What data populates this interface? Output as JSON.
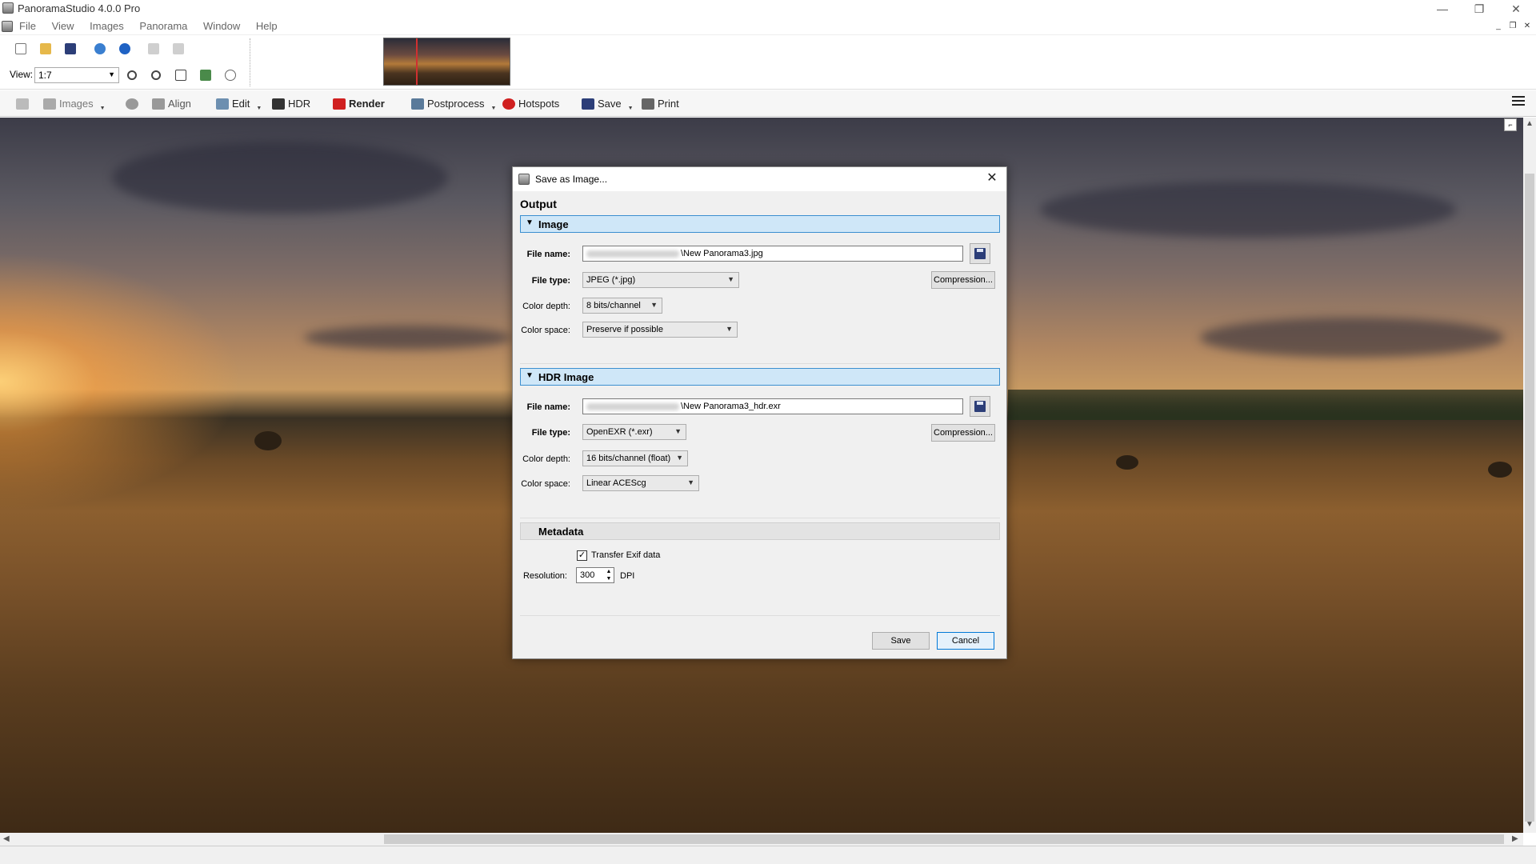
{
  "window": {
    "title": "PanoramaStudio 4.0.0 Pro",
    "minimize": "—",
    "restore": "❐",
    "close": "✕"
  },
  "menubar": [
    "File",
    "View",
    "Images",
    "Panorama",
    "Window",
    "Help"
  ],
  "view": {
    "label": "View:",
    "zoom": "1:7"
  },
  "workflow": {
    "images": "Images",
    "align": "Align",
    "edit": "Edit",
    "hdr": "HDR",
    "render": "Render",
    "postprocess": "Postprocess",
    "hotspots": "Hotspots",
    "save": "Save",
    "print": "Print"
  },
  "dialog": {
    "title": "Save as Image...",
    "heading": "Output",
    "image_section": {
      "title": "Image",
      "file_name_label": "File name:",
      "file_name": "\\New Panorama3.jpg",
      "file_type_label": "File type:",
      "file_type": "JPEG (*.jpg)",
      "compression": "Compression...",
      "color_depth_label": "Color depth:",
      "color_depth": "8 bits/channel",
      "color_space_label": "Color space:",
      "color_space": "Preserve if possible"
    },
    "hdr_section": {
      "title": "HDR Image",
      "file_name_label": "File name:",
      "file_name": "\\New Panorama3_hdr.exr",
      "file_type_label": "File type:",
      "file_type": "OpenEXR (*.exr)",
      "compression": "Compression...",
      "color_depth_label": "Color depth:",
      "color_depth": "16 bits/channel (float)",
      "color_space_label": "Color space:",
      "color_space": "Linear ACEScg"
    },
    "metadata_section": {
      "title": "Metadata",
      "transfer_exif_label": "Transfer Exif data",
      "transfer_exif_checked": true,
      "resolution_label": "Resolution:",
      "resolution": "300",
      "resolution_unit": "DPI"
    },
    "save_button": "Save",
    "cancel_button": "Cancel"
  },
  "colors": {
    "section_header": "#cfe7f8",
    "section_border": "#3c8fd0",
    "default_button": "#0078d7"
  }
}
